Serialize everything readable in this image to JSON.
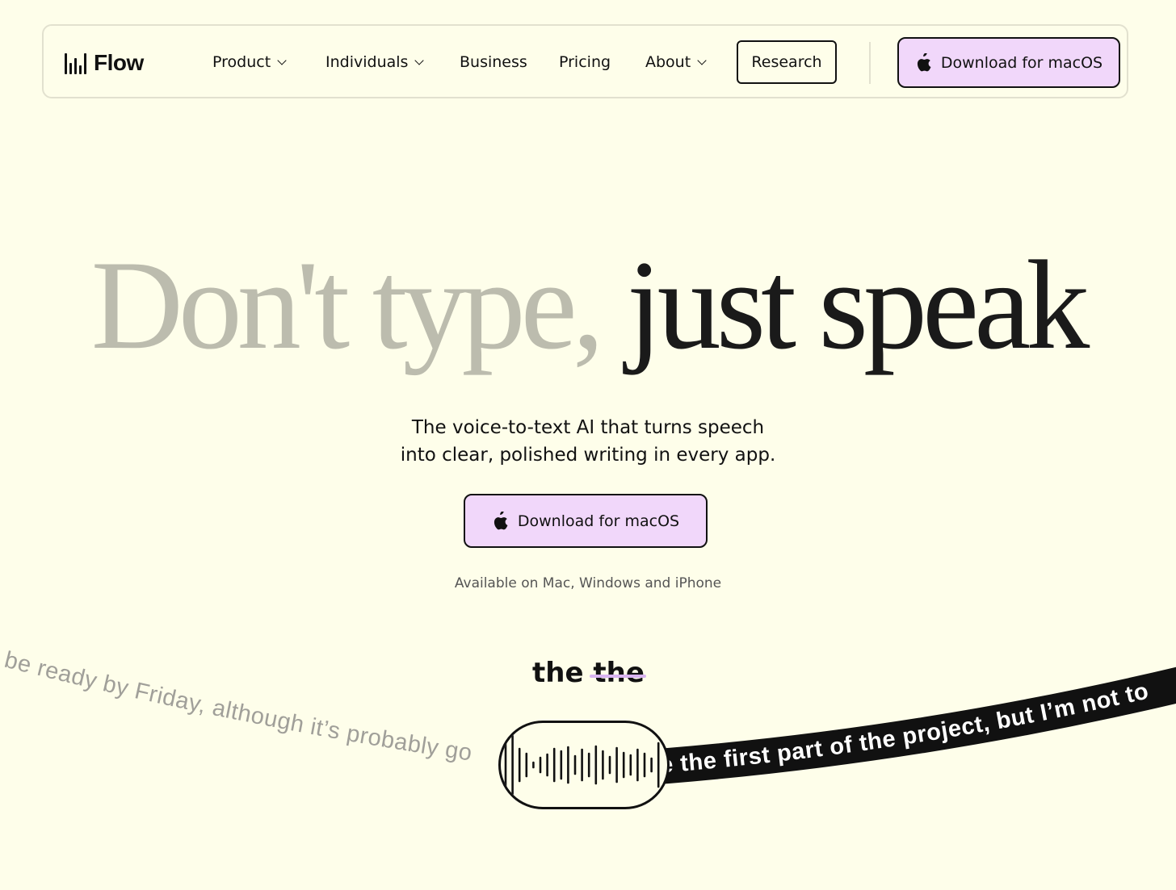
{
  "nav": {
    "logo_text": "Flow",
    "items": [
      {
        "label": "Product",
        "has_dropdown": true
      },
      {
        "label": "Individuals",
        "has_dropdown": true
      },
      {
        "label": "Business",
        "has_dropdown": false
      },
      {
        "label": "Pricing",
        "has_dropdown": false
      },
      {
        "label": "About",
        "has_dropdown": true
      }
    ],
    "research_label": "Research",
    "download_label": "Download for macOS"
  },
  "hero": {
    "headline_muted": "Don't type,",
    "headline_strong": "just speak",
    "subtitle_line1": "The voice-to-text AI that turns speech",
    "subtitle_line2": "into clear, polished writing in every app.",
    "cta_label": "Download for macOS",
    "availability": "Available on Mac, Windows and iPhone"
  },
  "demo": {
    "correction_kept": "the",
    "correction_removed": "the",
    "raw_text": "be ready by Friday, although it’s probably go",
    "polished_text": "e the first part of the project, but I’m not to"
  },
  "colors": {
    "background": "#fefeea",
    "accent": "#f1d7fa",
    "strike": "#d8b3f0",
    "muted_headline": "#bcbcae",
    "ink": "#111111"
  },
  "icons": {
    "logo": "waveform-bars-icon",
    "apple": "apple-icon",
    "dropdown": "chevron-down-icon"
  }
}
